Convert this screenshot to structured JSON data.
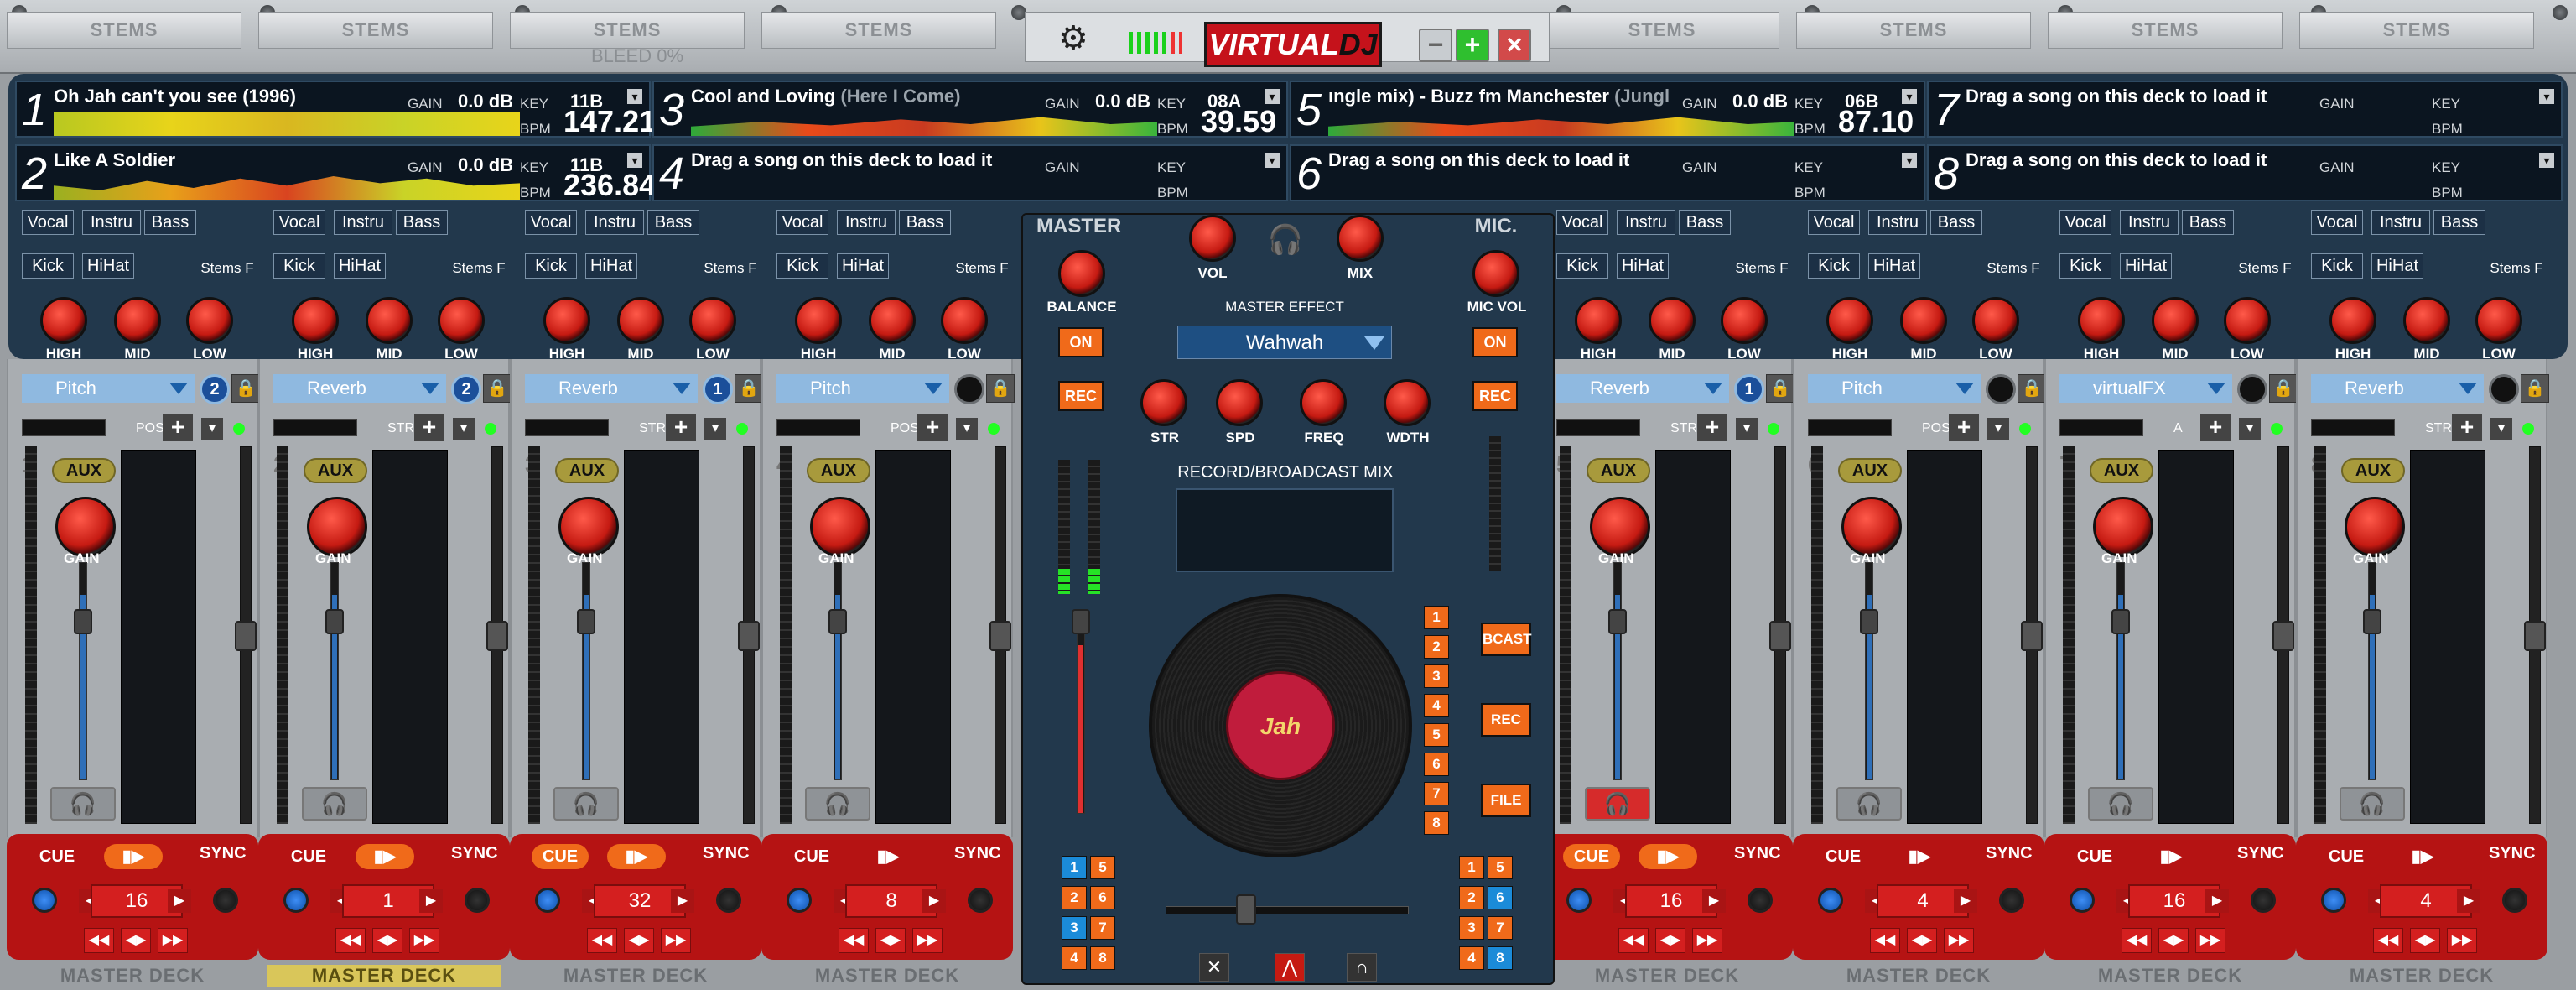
{
  "top": {
    "stems_label": "STEMS",
    "bleed": "BLEED 0%",
    "logo_a": "VIRTUAL",
    "logo_b": "DJ",
    "min": "−",
    "max": "+",
    "close": "×"
  },
  "decks": [
    {
      "num": "1",
      "title": "Oh Jah can't you see (1996)",
      "title_dim": "",
      "gain_label": "GAIN",
      "gain": "0.0 dB",
      "key_label": "KEY",
      "key": "11B",
      "bpm_label": "BPM",
      "bpm": "147.21"
    },
    {
      "num": "2",
      "title": "Like A Soldier",
      "title_dim": "",
      "gain_label": "GAIN",
      "gain": "0.0 dB",
      "key_label": "KEY",
      "key": "11B",
      "bpm_label": "BPM",
      "bpm": "236.84"
    },
    {
      "num": "3",
      "title": "Cool and Loving ",
      "title_dim": "(Here I Come)",
      "gain_label": "GAIN",
      "gain": "0.0 dB",
      "key_label": "KEY",
      "key": "08A",
      "bpm_label": "BPM",
      "bpm": "39.59"
    },
    {
      "num": "4",
      "title": "Drag a song on this deck to load it",
      "title_dim": "",
      "gain_label": "GAIN",
      "gain": "",
      "key_label": "KEY",
      "key": "",
      "bpm_label": "BPM",
      "bpm": ""
    },
    {
      "num": "5",
      "title": "ıngle mix) - Buzz fm Manchester ",
      "title_dim": "(Jungl",
      "gain_label": "GAIN",
      "gain": "0.0 dB",
      "key_label": "KEY",
      "key": "06B",
      "bpm_label": "BPM",
      "bpm": "87.10"
    },
    {
      "num": "6",
      "title": "Drag a song on this deck to load it",
      "title_dim": "",
      "gain_label": "GAIN",
      "gain": "",
      "key_label": "KEY",
      "key": "",
      "bpm_label": "BPM",
      "bpm": ""
    },
    {
      "num": "7",
      "title": "Drag a song on this deck to load it",
      "title_dim": "",
      "gain_label": "GAIN",
      "gain": "",
      "key_label": "KEY",
      "key": "",
      "bpm_label": "BPM",
      "bpm": ""
    },
    {
      "num": "8",
      "title": "Drag a song on this deck to load it",
      "title_dim": "",
      "gain_label": "GAIN",
      "gain": "",
      "key_label": "KEY",
      "key": "",
      "bpm_label": "BPM",
      "bpm": ""
    }
  ],
  "stems": {
    "vocal": "Vocal",
    "instru": "Instru",
    "bass": "Bass",
    "kick": "Kick",
    "hihat": "HiHat",
    "stemsf": "Stems F",
    "high": "HIGH",
    "mid": "MID",
    "low": "LOW"
  },
  "channels": [
    {
      "num": "1",
      "fx": "Pitch",
      "fxn": "2",
      "mode": "POS",
      "aux": "AUX",
      "gain": "GAIN",
      "loop": "16",
      "cue": "CUE",
      "play": "▮▶",
      "sync": "SYNC",
      "master": "MASTER DECK"
    },
    {
      "num": "2",
      "fx": "Reverb",
      "fxn": "2",
      "mode": "STR",
      "aux": "AUX",
      "gain": "GAIN",
      "loop": "1",
      "cue": "CUE",
      "play": "▮▶",
      "sync": "SYNC",
      "master": "MASTER DECK"
    },
    {
      "num": "3",
      "fx": "Reverb",
      "fxn": "1",
      "mode": "STR",
      "aux": "AUX",
      "gain": "GAIN",
      "loop": "32",
      "cue": "CUE",
      "play": "▮▶",
      "sync": "SYNC",
      "master": "MASTER DECK"
    },
    {
      "num": "4",
      "fx": "Pitch",
      "fxn": "",
      "mode": "POS",
      "aux": "AUX",
      "gain": "GAIN",
      "loop": "8",
      "cue": "CUE",
      "play": "▮▶",
      "sync": "SYNC",
      "master": "MASTER DECK"
    },
    {
      "num": "5",
      "fx": "Reverb",
      "fxn": "1",
      "mode": "STR",
      "aux": "AUX",
      "gain": "GAIN",
      "loop": "16",
      "cue": "CUE",
      "play": "▮▶",
      "sync": "SYNC",
      "master": "MASTER DECK"
    },
    {
      "num": "6",
      "fx": "Pitch",
      "fxn": "",
      "mode": "POS",
      "aux": "AUX",
      "gain": "GAIN",
      "loop": "4",
      "cue": "CUE",
      "play": "▮▶",
      "sync": "SYNC",
      "master": "MASTER DECK"
    },
    {
      "num": "7",
      "fx": "virtualFX",
      "fxn": "",
      "mode": "A",
      "aux": "AUX",
      "gain": "GAIN",
      "loop": "16",
      "cue": "CUE",
      "play": "▮▶",
      "sync": "SYNC",
      "master": "MASTER DECK"
    },
    {
      "num": "8",
      "fx": "Reverb",
      "fxn": "",
      "mode": "STR",
      "aux": "AUX",
      "gain": "GAIN",
      "loop": "4",
      "cue": "CUE",
      "play": "▮▶",
      "sync": "SYNC",
      "master": "MASTER DECK"
    }
  ],
  "mixer": {
    "master": "MASTER",
    "balance": "BALANCE",
    "vol": "VOL",
    "mix": "MIX",
    "mic": "MIC.",
    "micvol": "MIC VOL",
    "master_effect": "MASTER EFFECT",
    "effect": "Wahwah",
    "on": "ON",
    "rec": "REC",
    "str": "STR",
    "spd": "SPD",
    "freq": "FREQ",
    "wdth": "WDTH",
    "record_title": "RECORD/BROADCAST MIX",
    "bcast": "BCAST",
    "file": "FILE",
    "label_text": "Jah",
    "sampler": [
      "1",
      "2",
      "3",
      "4",
      "5",
      "6",
      "7",
      "8"
    ]
  }
}
